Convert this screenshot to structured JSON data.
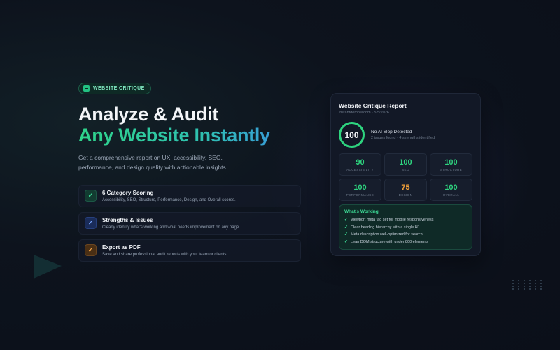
{
  "colors": {
    "accent_green": "#2ed47f",
    "accent_orange": "#f5a23a",
    "background": "#0d121c"
  },
  "badge": {
    "label": "WEBSITE CRITIQUE",
    "icon": "document-icon"
  },
  "hero": {
    "title_line1": "Analyze & Audit",
    "title_line2": "Any Website Instantly",
    "description": "Get a comprehensive report on UX, accessibility, SEO, performance, and design quality with actionable insights."
  },
  "features": [
    {
      "title": "6 Category Scoring",
      "description": "Accessibility, SEO, Structure, Performance, Design, and Overall scores.",
      "check": "✓"
    },
    {
      "title": "Strengths & Issues",
      "description": "Clearly identify what's working and what needs improvement on any page.",
      "check": "✓"
    },
    {
      "title": "Export as PDF",
      "description": "Save and share professional audit reports with your team or clients.",
      "check": "✓"
    }
  ],
  "report": {
    "title": "Website Critique Report",
    "subtitle": "instantdemow.com · 5/5/2026",
    "score": "100",
    "status_title": "No AI Slop Detected",
    "status_detail": "2 issues found · 4 strengths identified",
    "metrics": [
      {
        "value": "90",
        "label": "ACCESSIBILITY",
        "color": "#2ed47f"
      },
      {
        "value": "100",
        "label": "SEO",
        "color": "#2ed47f"
      },
      {
        "value": "100",
        "label": "STRUCTURE",
        "color": "#2ed47f"
      },
      {
        "value": "100",
        "label": "PERFORMANCE",
        "color": "#2ed47f"
      },
      {
        "value": "75",
        "label": "DESIGN",
        "color": "#f5a23a"
      },
      {
        "value": "100",
        "label": "OVERALL",
        "color": "#2ed47f"
      }
    ],
    "working_title": "What's Working",
    "working_items": [
      "Viewport meta tag set for mobile responsiveness",
      "Clear heading hierarchy with a single H1",
      "Meta description well-optimized for search",
      "Lean DOM structure with under 800 elements"
    ],
    "check": "✓"
  }
}
